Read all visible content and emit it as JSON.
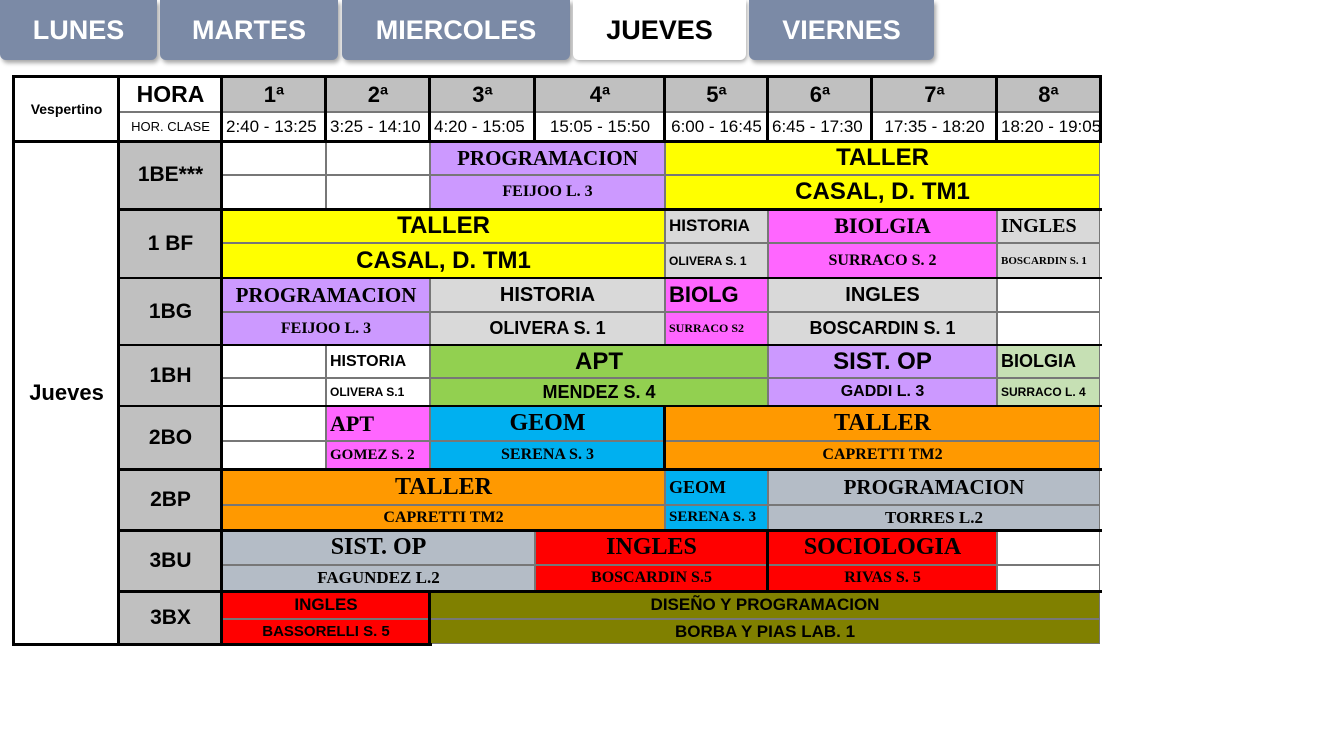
{
  "tabs": [
    {
      "label": "LUNES"
    },
    {
      "label": "MARTES"
    },
    {
      "label": "MIERCOLES"
    },
    {
      "label": "JUEVES",
      "active": true
    },
    {
      "label": "VIERNES"
    }
  ],
  "header": {
    "shift": "Vespertino",
    "hora": "HORA",
    "hor_clase": "HOR. CLASE",
    "periods": [
      "1ª",
      "2ª",
      "3ª",
      "4ª",
      "5ª",
      "6ª",
      "7ª",
      "8ª"
    ],
    "times": [
      "2:40 - 13:25",
      "3:25 - 14:10",
      "4:20 - 15:05",
      "15:05 - 15:50",
      "6:00 - 16:45",
      "6:45 - 17:30",
      "17:35 - 18:20",
      "18:20 - 19:05"
    ]
  },
  "day": "Jueves",
  "groups": [
    "1BE***",
    "1 BF",
    "1BG",
    "1BH",
    "2BO",
    "2BP",
    "3BU",
    "3BX"
  ],
  "colors": {
    "yellow": "#ffff00",
    "lilac": "#cc99ff",
    "grey": "#d9d9d9",
    "pink": "#ff66ff",
    "green": "#92d050",
    "lightgreen": "#c6e0b4",
    "blue": "#00b0f0",
    "orange": "#ff9900",
    "slate": "#b4bcc6",
    "red": "#ff0000",
    "olive": "#808000",
    "header_grey": "#c0c0c0"
  },
  "schedule": {
    "1BE": {
      "programacion": "PROGRAMACION",
      "feijoo": "FEIJOO  L. 3",
      "taller": "TALLER",
      "casal": "CASAL, D. TM1"
    },
    "1BF": {
      "taller": "TALLER",
      "casal": "CASAL, D. TM1",
      "historia": "HISTORIA",
      "olivera": "OLIVERA S. 1",
      "biolgia": "BIOLGIA",
      "surraco": "SURRACO  S. 2",
      "ingles": "INGLES",
      "boscardin": "BOSCARDIN S. 1"
    },
    "1BG": {
      "programacion": "PROGRAMACION",
      "feijoo": "FEIJOO  L. 3",
      "historia": "HISTORIA",
      "olivera": "OLIVERA S. 1",
      "biolg": "BIOLG",
      "surraco": "SURRACO S2",
      "ingles": "INGLES",
      "boscardin": "BOSCARDIN S. 1"
    },
    "1BH": {
      "historia": "HISTORIA",
      "olivera": "OLIVERA S.1",
      "apt": "APT",
      "mendez": "MENDEZ  S. 4",
      "sist": "SIST. OP",
      "gaddi": "GADDI  L. 3",
      "biolgia": "BIOLGIA",
      "surraco": "SURRACO L. 4"
    },
    "2BO": {
      "apt": "APT",
      "gomez": "GOMEZ S. 2",
      "geom": "GEOM",
      "serena": "SERENA S. 3",
      "taller": "TALLER",
      "capretti": "CAPRETTI   TM2"
    },
    "2BP": {
      "taller": "TALLER",
      "capretti": "CAPRETTI   TM2",
      "geom": "GEOM",
      "serena": "SERENA S. 3",
      "programacion": "PROGRAMACION",
      "torres": "TORRES  L.2"
    },
    "3BU": {
      "sist": "SIST. OP",
      "fagundez": "FAGUNDEZ  L.2",
      "ingles": "INGLES",
      "boscardin": "BOSCARDIN  S.5",
      "sociologia": "SOCIOLOGIA",
      "rivas": "RIVAS  S. 5"
    },
    "3BX": {
      "ingles": "INGLES",
      "bassorelli": "BASSORELLI  S. 5",
      "diseno": "DISEÑO Y PROGRAMACION",
      "borba": "BORBA    Y    PIAS  LAB. 1"
    }
  }
}
